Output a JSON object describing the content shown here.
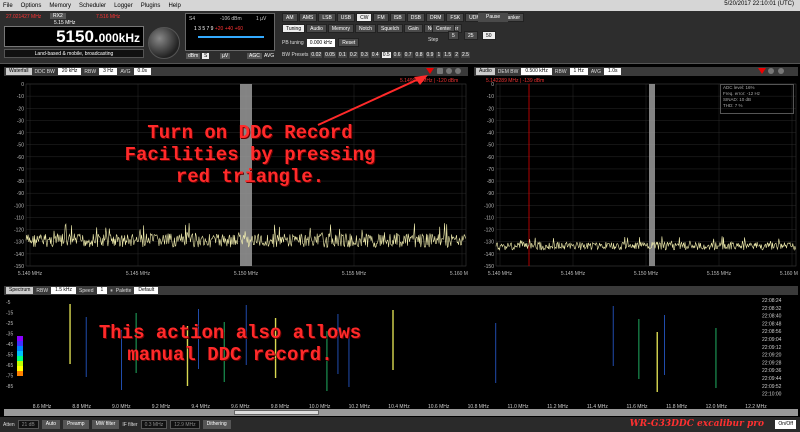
{
  "menubar": {
    "items": [
      "File",
      "Options",
      "Memory",
      "Scheduler",
      "Logger",
      "Plugins",
      "Help"
    ],
    "clock": "5/20/2017 22:10:01 (UTC)"
  },
  "receiver": {
    "freq_left_small": "27.021427 MHz",
    "rx_label": "RX2",
    "freq_mid_small": "5.15 MHz",
    "freq_right_small": "7.516 MHz",
    "main_freq": "5150.",
    "main_freq_sub": "000kHz",
    "band_info": "Land-based & mobile, broadcasting"
  },
  "smeter": {
    "s_label": "S4",
    "dbm": "-106 dBm",
    "uv": "1 µV",
    "scale": "1 3 5 7 9",
    "scale_red": "+20 +40 +60",
    "dbm_btn": "dBm",
    "s_btn": "S",
    "uv_btn": "µV",
    "agc_label": "AGC",
    "avg_label": "AVG"
  },
  "modes": [
    "AM",
    "AMS",
    "LSB",
    "USB",
    "CW",
    "FM",
    "ISB",
    "DSB",
    "DRM",
    "FSK",
    "UDM"
  ],
  "active_mode": "CW",
  "noise_blanker": "Noise blanker",
  "pause": "Pause",
  "subtabs": [
    "Tuning",
    "Audio",
    "Memory",
    "Notch",
    "Squelch",
    "Gain",
    "Noise blanker"
  ],
  "pb_tuning": {
    "label": "PB tuning",
    "value": "0.000 kHz",
    "reset": "Reset"
  },
  "bw_presets": {
    "label": "BW Presets",
    "values": [
      "0.02",
      "0.05",
      "0.1",
      "0.2",
      "0.3",
      "0.4",
      "0.5",
      "0.6",
      "0.7",
      "0.8",
      "0.9",
      "1",
      "1.5",
      "2",
      "2.5"
    ],
    "active": "0.5"
  },
  "step": {
    "center": "Center",
    "label": "Step",
    "values": [
      "5",
      "25",
      "50"
    ]
  },
  "left_panel": {
    "tab": "Waterfall",
    "ddc_bw_label": "DDC BW",
    "ddc_bw": "20 kHz",
    "rbw_label": "RBW",
    "rbw": "3 Hz",
    "avg_label": "AVG",
    "avg": "0.0s",
    "marker": "5.149970 MHz | -120 dBm",
    "y_ticks": [
      "0",
      "-10",
      "-20",
      "-30",
      "-40",
      "-50",
      "-60",
      "-70",
      "-80",
      "-90",
      "-100",
      "-110",
      "-120",
      "-130",
      "-140",
      "-150"
    ],
    "x_ticks": [
      "5.140 MHz",
      "5.145 MHz",
      "5.150 MHz",
      "5.155 MHz",
      "5.160 MHz"
    ]
  },
  "right_panel": {
    "tab": "Audio",
    "dem_bw_label": "DEM BW",
    "dem_bw": "0.500 kHz",
    "rbw_label": "RBW",
    "rbw": "1 Hz",
    "avg_label": "AVG",
    "avg": "1.0s",
    "marker": "5.142289 MHz | -139 dBm",
    "y_ticks": [
      "0",
      "-10",
      "-20",
      "-30",
      "-40",
      "-50",
      "-60",
      "-70",
      "-80",
      "-90",
      "-100",
      "-110",
      "-120",
      "-130",
      "-140",
      "-150"
    ],
    "x_ticks": [
      "5.140 MHz",
      "5.145 MHz",
      "5.150 MHz",
      "5.155 MHz",
      "5.160 MHz"
    ],
    "adc": [
      "ADC level: 16%",
      "Freq. error: -12 Hz",
      "SINAD: 10 dB",
      "THD: 7 %"
    ]
  },
  "spectrum_bar": {
    "tab": "Spectrum",
    "rbw_label": "RBW",
    "rbw": "1.5 kHz",
    "speed_label": "Speed",
    "speed": "1",
    "palette_label": "Palette",
    "palette": "Default"
  },
  "waterfall": {
    "y_ticks": [
      "-5",
      "-15",
      "-25",
      "-35",
      "-45",
      "-55",
      "-65",
      "-75",
      "-85"
    ],
    "x_ticks": [
      "8.6 MHz",
      "8.8 MHz",
      "9.0 MHz",
      "9.2 MHz",
      "9.4 MHz",
      "9.6 MHz",
      "9.8 MHz",
      "10.0 MHz",
      "10.2 MHz",
      "10.4 MHz",
      "10.6 MHz",
      "10.8 MHz",
      "11.0 MHz",
      "11.2 MHz",
      "11.4 MHz",
      "11.6 MHz",
      "11.8 MHz",
      "12.0 MHz",
      "12.2 MHz"
    ],
    "times": [
      "22:08:24",
      "22:08:32",
      "22:08:40",
      "22:08:48",
      "22:08:56",
      "22:09:04",
      "22:09:12",
      "22:09:20",
      "22:09:28",
      "22:09:36",
      "22:09:44",
      "22:09:52",
      "22:10:00"
    ]
  },
  "annotations": {
    "top": [
      "Turn on DDC Record",
      "Facilities by pressing",
      "red triangle."
    ],
    "bottom": [
      "This action also allows",
      "manual DDC record."
    ]
  },
  "bottombar": {
    "atten_label": "Atten",
    "atten": "21 dB",
    "auto": "Auto",
    "preamp": "Preamp",
    "mw_filter": "MW filter",
    "if_filter_label": "IF filter",
    "if_filter": "0.3 MHz",
    "if_filter2": "12.9 MHz",
    "dithering": "Dithering",
    "brand": "WR-G33DDC excalibur pro",
    "onoff": "On/Off"
  },
  "colors": {
    "annotation": "#ff2a2a",
    "trace": "#f4f0b0",
    "accent_red": "#e00000"
  }
}
